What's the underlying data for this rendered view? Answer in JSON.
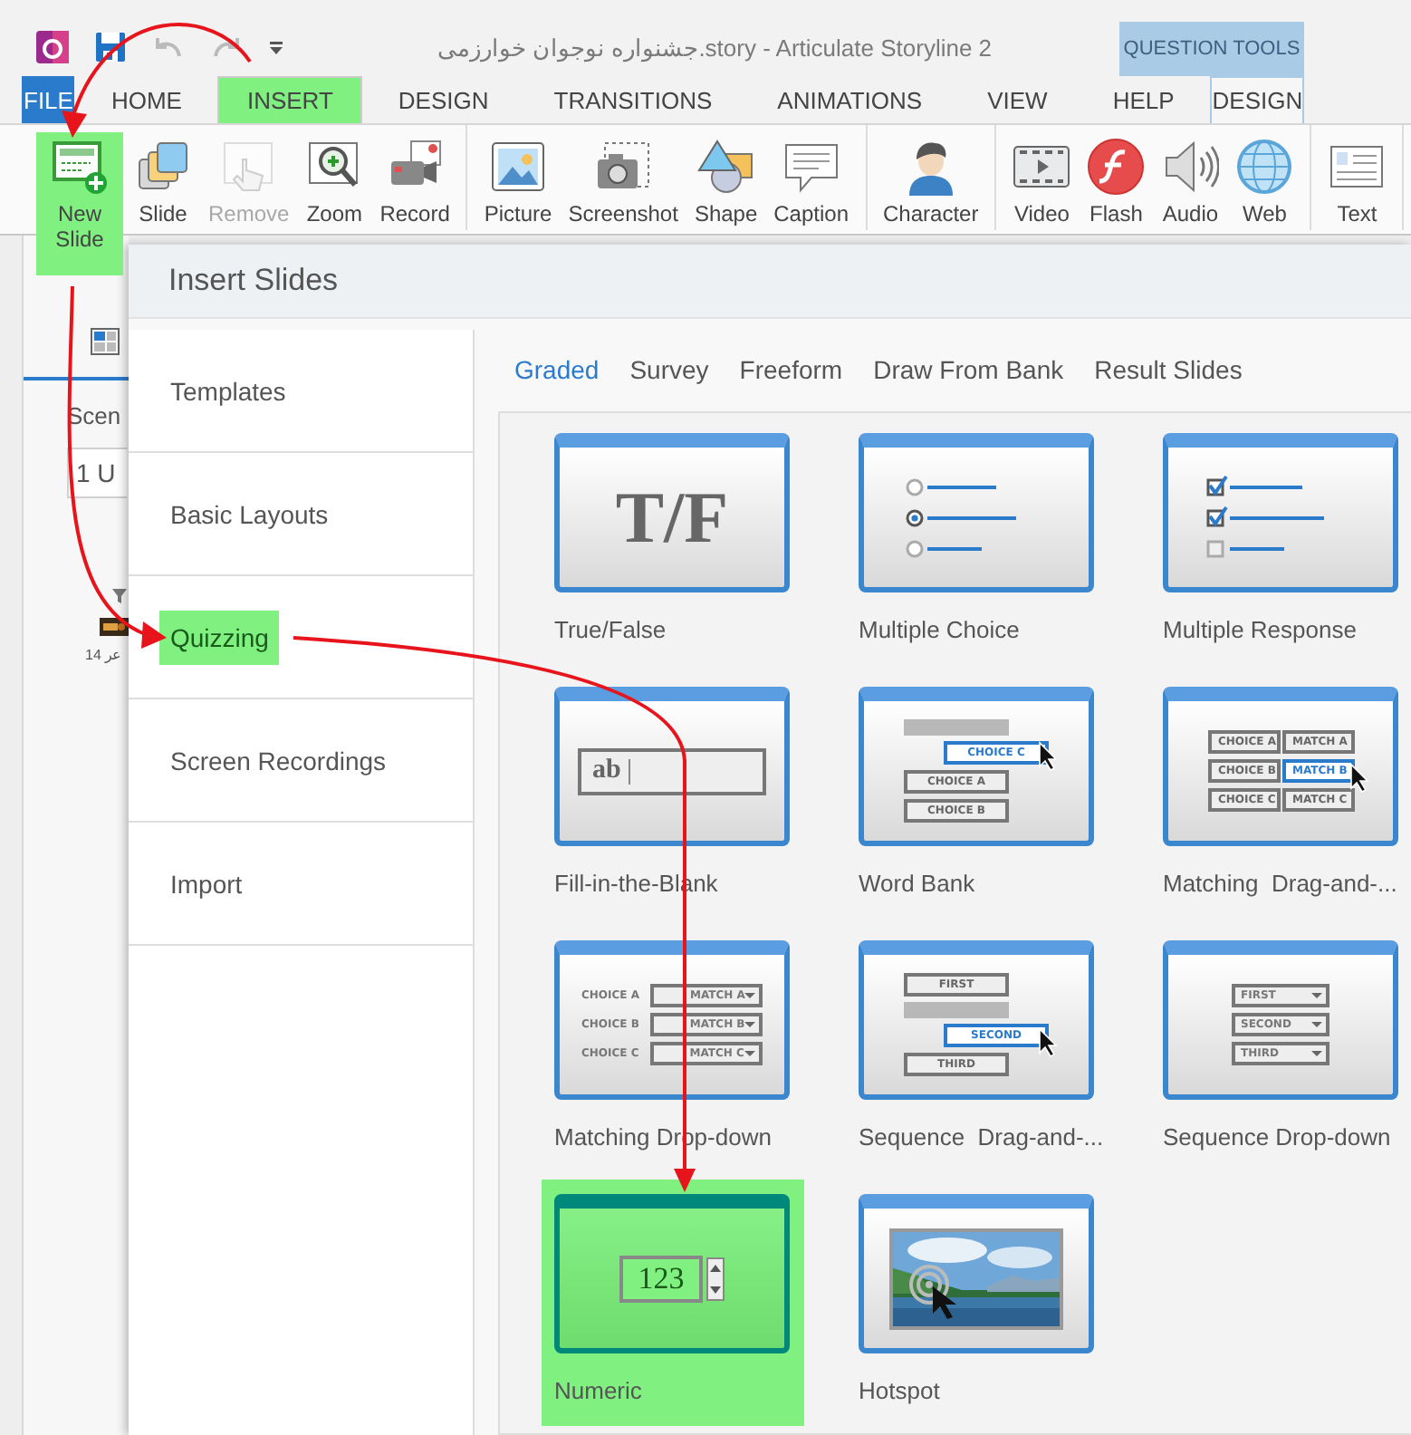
{
  "window": {
    "title": "جشنواره نوجوان خوارزمی.story -  Articulate Storyline 2",
    "contextual_group": "QUESTION TOOLS"
  },
  "tabs": [
    {
      "label": "FILE",
      "kind": "file",
      "selected": false,
      "highlighted": false
    },
    {
      "label": "HOME",
      "kind": "tab",
      "selected": false,
      "highlighted": false
    },
    {
      "label": "INSERT",
      "kind": "tab",
      "selected": true,
      "highlighted": true
    },
    {
      "label": "DESIGN",
      "kind": "tab",
      "selected": false,
      "highlighted": false
    },
    {
      "label": "TRANSITIONS",
      "kind": "tab",
      "selected": false,
      "highlighted": false
    },
    {
      "label": "ANIMATIONS",
      "kind": "tab",
      "selected": false,
      "highlighted": false
    },
    {
      "label": "VIEW",
      "kind": "tab",
      "selected": false,
      "highlighted": false
    },
    {
      "label": "HELP",
      "kind": "tab",
      "selected": false,
      "highlighted": false
    },
    {
      "label": "DESIGN",
      "kind": "contextual",
      "selected": false,
      "highlighted": false
    }
  ],
  "ribbon": {
    "groups": [
      [
        {
          "label": "New Slide",
          "disabled": false,
          "highlighted": true
        },
        {
          "label": "Slide",
          "disabled": false,
          "highlighted": false
        },
        {
          "label": "Remove",
          "disabled": true,
          "highlighted": false
        },
        {
          "label": "Zoom",
          "disabled": false,
          "highlighted": false
        },
        {
          "label": "Record",
          "disabled": false,
          "highlighted": false
        }
      ],
      [
        {
          "label": "Picture",
          "disabled": false,
          "highlighted": false
        },
        {
          "label": "Screenshot",
          "disabled": false,
          "highlighted": false
        },
        {
          "label": "Shape",
          "disabled": false,
          "highlighted": false
        },
        {
          "label": "Caption",
          "disabled": false,
          "highlighted": false
        }
      ],
      [
        {
          "label": "Character",
          "disabled": false,
          "highlighted": false
        }
      ],
      [
        {
          "label": "Video",
          "disabled": false,
          "highlighted": false
        },
        {
          "label": "Flash",
          "disabled": false,
          "highlighted": false
        },
        {
          "label": "Audio",
          "disabled": false,
          "highlighted": false
        },
        {
          "label": "Web",
          "disabled": false,
          "highlighted": false
        }
      ],
      [
        {
          "label": "Text",
          "disabled": false,
          "highlighted": false
        }
      ]
    ]
  },
  "side_pane": {
    "heading": "Scen",
    "scene_field": "1 U",
    "slide_caption": "عر 14"
  },
  "dialog": {
    "title": "Insert Slides",
    "nav": [
      {
        "label": "Templates",
        "highlighted": false
      },
      {
        "label": "Basic Layouts",
        "highlighted": false
      },
      {
        "label": "Quizzing",
        "highlighted": true
      },
      {
        "label": "Screen Recordings",
        "highlighted": false
      },
      {
        "label": "Import",
        "highlighted": false
      }
    ],
    "tabs": [
      {
        "label": "Graded",
        "selected": true
      },
      {
        "label": "Survey",
        "selected": false
      },
      {
        "label": "Freeform",
        "selected": false
      },
      {
        "label": "Draw From Bank",
        "selected": false
      },
      {
        "label": "Result Slides",
        "selected": false
      }
    ],
    "tiles": [
      {
        "label": "True/False",
        "kind": "tf",
        "highlighted": false,
        "texts": [
          "T/F"
        ]
      },
      {
        "label": "Multiple Choice",
        "kind": "mc",
        "highlighted": false
      },
      {
        "label": "Multiple Response",
        "kind": "mr",
        "highlighted": false
      },
      {
        "label": "Fill-in-the-Blank",
        "kind": "fib",
        "highlighted": false,
        "texts": [
          "ab"
        ]
      },
      {
        "label": "Word Bank",
        "kind": "wordbank",
        "highlighted": false,
        "texts": [
          "CHOICE C",
          "CHOICE A",
          "CHOICE B"
        ]
      },
      {
        "label": "Matching  Drag-and-...",
        "kind": "matchdrag",
        "highlighted": false,
        "texts": [
          "CHOICE A",
          "MATCH A",
          "CHOICE B",
          "MATCH B",
          "CHOICE C",
          "MATCH C"
        ]
      },
      {
        "label": "Matching Drop-down",
        "kind": "matchdrop",
        "highlighted": false,
        "texts": [
          "CHOICE A",
          "MATCH A",
          "CHOICE B",
          "MATCH B",
          "CHOICE C",
          "MATCH C"
        ]
      },
      {
        "label": "Sequence  Drag-and-...",
        "kind": "seqdrag",
        "highlighted": false,
        "texts": [
          "FIRST",
          "SECOND",
          "THIRD"
        ]
      },
      {
        "label": "Sequence Drop-down",
        "kind": "seqdrop",
        "highlighted": false,
        "texts": [
          "FIRST",
          "SECOND",
          "THIRD"
        ]
      },
      {
        "label": "Numeric",
        "kind": "numeric",
        "highlighted": true,
        "texts": [
          "123"
        ]
      },
      {
        "label": "Hotspot",
        "kind": "hotspot",
        "highlighted": false
      }
    ]
  }
}
